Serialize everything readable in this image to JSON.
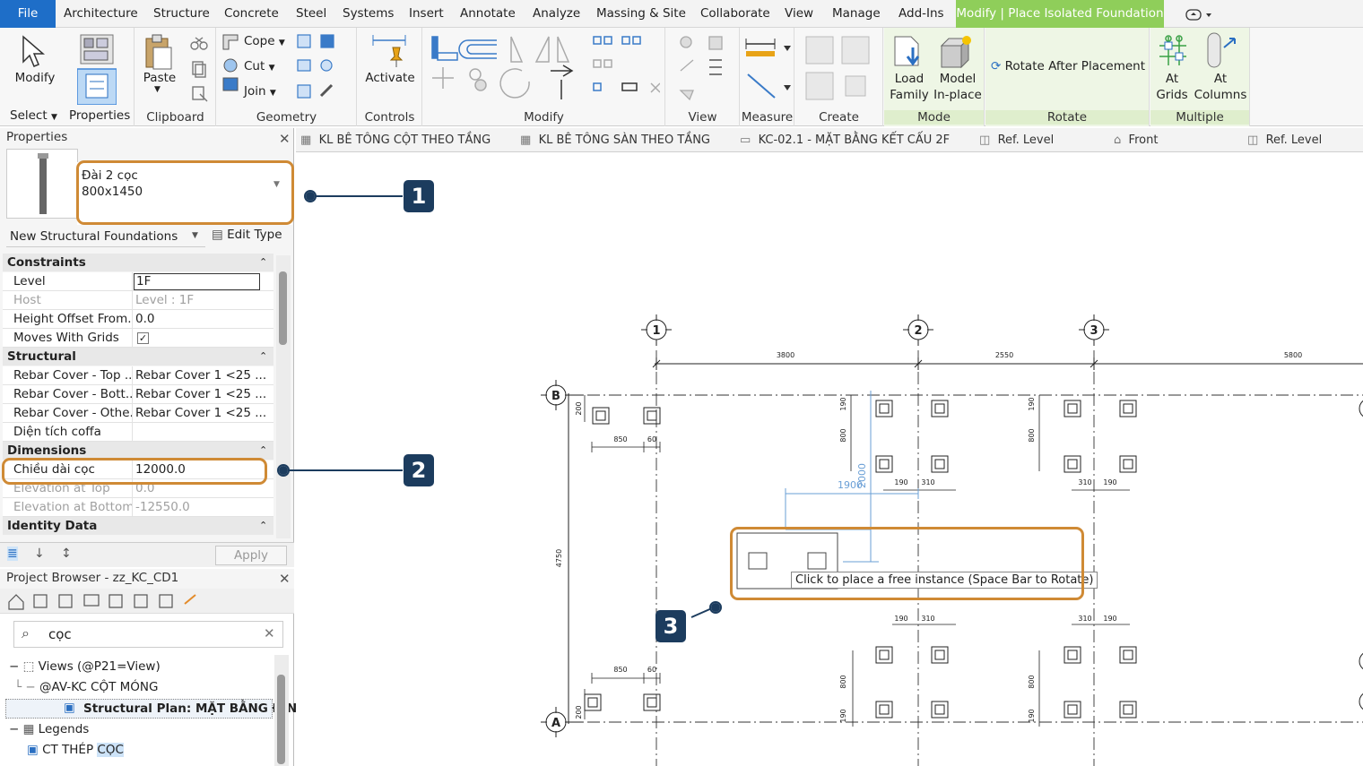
{
  "menu": {
    "file": "File",
    "tabs": [
      "Architecture",
      "Structure",
      "Concrete",
      "Steel",
      "Systems",
      "Insert",
      "Annotate",
      "Analyze",
      "Massing & Site",
      "Collaborate",
      "View",
      "Manage",
      "Add-Ins"
    ],
    "context_tab": "Modify | Place Isolated Foundation"
  },
  "ribbon": {
    "select": {
      "modify": "Modify",
      "label": "Select",
      "properties": "Properties"
    },
    "clipboard": {
      "paste": "Paste",
      "label": "Clipboard"
    },
    "geometry": {
      "cope": "Cope",
      "cut": "Cut",
      "join": "Join",
      "label": "Geometry"
    },
    "controls": {
      "activate": "Activate",
      "label": "Controls"
    },
    "modify_label": "Modify",
    "view_label": "View",
    "measure_label": "Measure",
    "create_label": "Create",
    "mode": {
      "load_family_1": "Load",
      "load_family_2": "Family",
      "model_inplace_1": "Model",
      "model_inplace_2": "In-place",
      "label": "Mode"
    },
    "rotate": {
      "rotate_after": "Rotate After Placement",
      "label": "Rotate"
    },
    "multiple": {
      "at_grids_1": "At",
      "at_grids_2": "Grids",
      "at_columns_1": "At",
      "at_columns_2": "Columns",
      "label": "Multiple"
    }
  },
  "view_tabs": [
    "KL BÊ TÔNG CỘT THEO TẦNG",
    "KL BÊ TÔNG SÀN THEO TẦNG",
    "KC-02.1 - MẶT BẰNG KẾT CẤU 2F",
    "Ref. Level",
    "Front",
    "Ref. Level"
  ],
  "properties": {
    "title": "Properties",
    "type_name_1": "Đài 2 cọc",
    "type_name_2": "800x1450",
    "instance_filter": "New Structural Foundations",
    "edit_type": "Edit Type",
    "apply": "Apply",
    "groups": {
      "constraints": "Constraints",
      "structural": "Structural",
      "dimensions": "Dimensions",
      "identity": "Identity Data"
    },
    "rows": {
      "level": {
        "k": "Level",
        "v": "1F"
      },
      "host": {
        "k": "Host",
        "v": "Level : 1F"
      },
      "height_offset": {
        "k": "Height Offset From...",
        "v": "0.0"
      },
      "moves_with_grids": {
        "k": "Moves With Grids",
        "v": ""
      },
      "rebar_top": {
        "k": "Rebar Cover - Top ...",
        "v": "Rebar Cover 1 <25 ..."
      },
      "rebar_bottom": {
        "k": "Rebar Cover - Bott...",
        "v": "Rebar Cover 1 <25 ..."
      },
      "rebar_other": {
        "k": "Rebar Cover - Othe...",
        "v": "Rebar Cover 1 <25 ..."
      },
      "dien_tich": {
        "k": "Diện tích coffa",
        "v": ""
      },
      "chieu_dai_coc": {
        "k": "Chiều dài cọc",
        "v": "12000.0"
      },
      "elev_top": {
        "k": "Elevation at Top",
        "v": "0.0"
      },
      "elev_bottom": {
        "k": "Elevation at Bottom",
        "v": "-12550.0"
      }
    }
  },
  "browser": {
    "title": "Project Browser - zz_KC_CD1",
    "search_value": "cọc",
    "items": {
      "views": "Views (@P21=View)",
      "av_kc": "@AV-KC CỘT MÓNG",
      "structural_plan": "Structural Plan: MẶT BẰNG ĐỊN",
      "legends": "Legends",
      "ct_thep_a": "CT THÉP ",
      "ct_thep_b": "CỌC"
    }
  },
  "canvas": {
    "grid_labels": [
      "1",
      "2",
      "3",
      "B",
      "A"
    ],
    "dims_top": [
      "3800",
      "2550",
      "5800"
    ],
    "dim_4750": "4750",
    "dim_850": "850",
    "dim_60": "60",
    "dim_200": "200",
    "dim_190": "190",
    "dim_310": "310",
    "dim_800": "800",
    "temp_dim_h": "1900",
    "temp_dim_v": "2000",
    "tooltip": "Click to place a free instance (Space Bar to Rotate)"
  },
  "annotations": [
    "1",
    "2",
    "3"
  ],
  "colors": {
    "accent": "#1e6ec8",
    "context_tab": "#8fce5a",
    "highlight": "#cf8a35",
    "badge": "#1c3c5e"
  }
}
